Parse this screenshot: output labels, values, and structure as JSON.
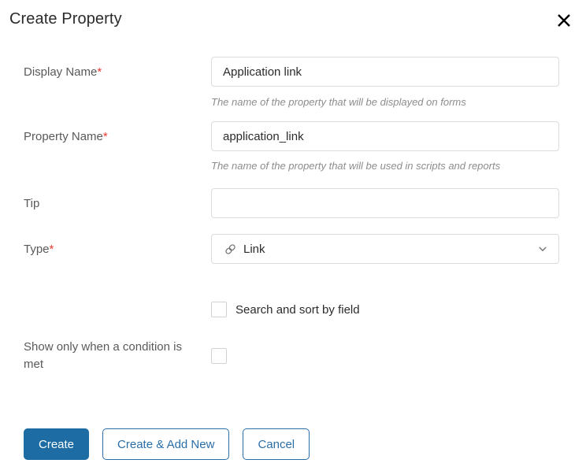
{
  "dialog": {
    "title": "Create Property",
    "close_icon": "close-icon"
  },
  "fields": {
    "display_name": {
      "label": "Display Name",
      "required_marker": "*",
      "value": "Application link",
      "placeholder": "",
      "hint": "The name of the property that will be displayed on forms"
    },
    "property_name": {
      "label": "Property Name",
      "required_marker": "*",
      "value": "application_link",
      "placeholder": "",
      "hint": "The name of the property that will be used in scripts and reports"
    },
    "tip": {
      "label": "Tip",
      "value": "",
      "placeholder": ""
    },
    "type": {
      "label": "Type",
      "required_marker": "*",
      "value": "Link",
      "icon": "link-icon",
      "chevron_icon": "chevron-down-icon"
    }
  },
  "checkboxes": {
    "search_and_sort": {
      "label": "Search and sort by field",
      "checked": false
    },
    "conditional_display": {
      "label": "Show only when a condition is met",
      "checked": false
    }
  },
  "footer": {
    "create_label": "Create",
    "create_add_new_label": "Create & Add New",
    "cancel_label": "Cancel"
  },
  "colors": {
    "primary": "#1d6ca4",
    "link_blue": "#2a6ea8",
    "required_red": "#e8392f",
    "border": "#dcdcdc",
    "hint_text": "#8d8d8d"
  }
}
